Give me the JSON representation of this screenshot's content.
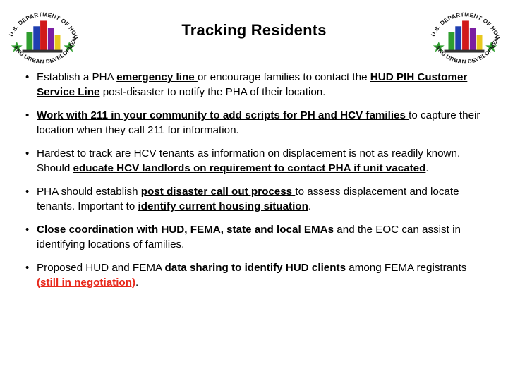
{
  "slide": {
    "title": "Tracking Residents",
    "bullet_mark": "•",
    "seal_left_name": "hud-seal-left",
    "seal_right_name": "hud-seal-right",
    "seal_text_top": "U.S. DEPARTMENT OF HOUSING",
    "seal_text_bottom": "AND URBAN DEVELOPMENT"
  },
  "bullets": [
    {
      "parts": [
        {
          "t": "Establish a PHA ",
          "s": "plain"
        },
        {
          "t": "emergency line ",
          "s": "underline"
        },
        {
          "t": "or encourage families to contact the ",
          "s": "plain"
        },
        {
          "t": "HUD PIH Customer Service Line",
          "s": "underline"
        },
        {
          "t": " post-disaster to notify the PHA of their location.",
          "s": "plain"
        }
      ]
    },
    {
      "parts": [
        {
          "t": "Work with 211 in your community to add scripts for PH and HCV families ",
          "s": "underline"
        },
        {
          "t": "to capture their location when they call 211 for information.",
          "s": "plain"
        }
      ]
    },
    {
      "parts": [
        {
          "t": "Hardest to track are HCV tenants as information on displacement  is not as readily known.  Should ",
          "s": "plain"
        },
        {
          "t": "educate HCV landlords on requirement to contact PHA if unit vacated",
          "s": "underline"
        },
        {
          "t": ".",
          "s": "plain"
        }
      ]
    },
    {
      "parts": [
        {
          "t": "PHA should establish ",
          "s": "plain"
        },
        {
          "t": "post disaster call out process ",
          "s": "underline"
        },
        {
          "t": "to assess displacement and locate tenants.  Important to ",
          "s": "plain"
        },
        {
          "t": "identify current housing situation",
          "s": "underline"
        },
        {
          "t": ".",
          "s": "plain"
        }
      ]
    },
    {
      "parts": [
        {
          "t": "Close coordination with HUD, FEMA, state and local EMAs ",
          "s": "underline"
        },
        {
          "t": "and the EOC can assist in identifying locations of families.",
          "s": "plain"
        }
      ]
    },
    {
      "parts": [
        {
          "t": "Proposed HUD and FEMA ",
          "s": "plain"
        },
        {
          "t": "data sharing to identify HUD clients ",
          "s": "underline"
        },
        {
          "t": "among FEMA registrants ",
          "s": "plain"
        },
        {
          "t": "(still in negotiation)",
          "s": "red"
        },
        {
          "t": ".",
          "s": "plain"
        }
      ]
    }
  ],
  "colors": {
    "red_accent": "#e8291c",
    "seal_green": "#2f9e2f",
    "seal_blue": "#1f3fb0",
    "seal_red": "#d11a1a",
    "seal_purple": "#7b1fa2",
    "seal_yellow": "#e8c81e"
  }
}
